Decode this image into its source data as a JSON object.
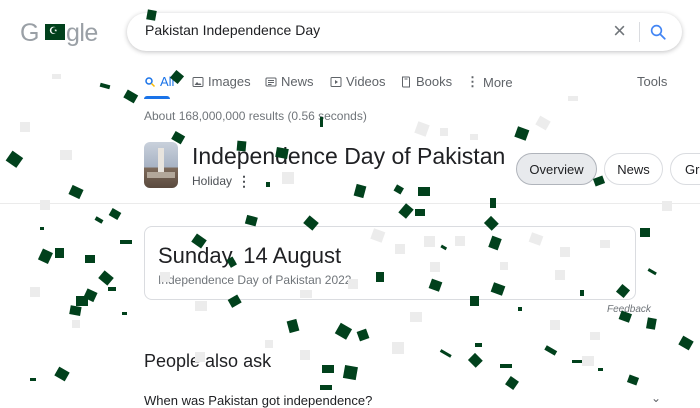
{
  "logo": {
    "prefix": "G",
    "suffix": "gle"
  },
  "search": {
    "query": "Pakistan Independence Day",
    "clear_label": "×"
  },
  "tabs": [
    {
      "label": "All",
      "icon": "search-icon"
    },
    {
      "label": "Images",
      "icon": "image-icon"
    },
    {
      "label": "News",
      "icon": "news-icon"
    },
    {
      "label": "Videos",
      "icon": "video-icon"
    },
    {
      "label": "Books",
      "icon": "book-icon"
    },
    {
      "label": "More",
      "icon": "more-vertical-icon"
    }
  ],
  "tools_label": "Tools",
  "result_stats": "About 168,000,000 results (0.56 seconds)",
  "knowledge_panel": {
    "title": "Independence Day of Pakistan",
    "subtitle": "Holiday",
    "more_label": "⋮",
    "chips": [
      "Overview",
      "News",
      "Gr"
    ]
  },
  "date_card": {
    "date": "Sunday, 14 August",
    "caption": "Independence Day of Pakistan 2022",
    "feedback": "Feedback"
  },
  "people_also_ask": {
    "title": "People also ask",
    "questions": [
      "When was Pakistan got independence?"
    ]
  },
  "colors": {
    "accent": "#1a73e8",
    "confetti_green": "#01411c",
    "confetti_white": "#f1f1f1"
  }
}
